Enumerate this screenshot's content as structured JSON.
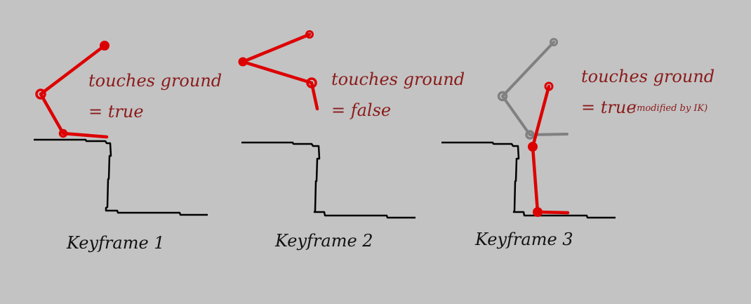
{
  "colors": {
    "background": "#c3c3c3",
    "leg_active": "#dd0000",
    "leg_previous": "#808080",
    "ground": "#000000",
    "label_red": "#8b1a1a",
    "caption": "#111111"
  },
  "keyframes": [
    {
      "status_text": "touches ground",
      "value_text": "= true",
      "note": "",
      "caption": "Keyframe 1"
    },
    {
      "status_text": "touches ground",
      "value_text": "= false",
      "note": "",
      "caption": "Keyframe 2"
    },
    {
      "status_text": "touches ground",
      "value_text": "= true",
      "note": "(modified by IK)",
      "caption": "Keyframe 3"
    }
  ]
}
